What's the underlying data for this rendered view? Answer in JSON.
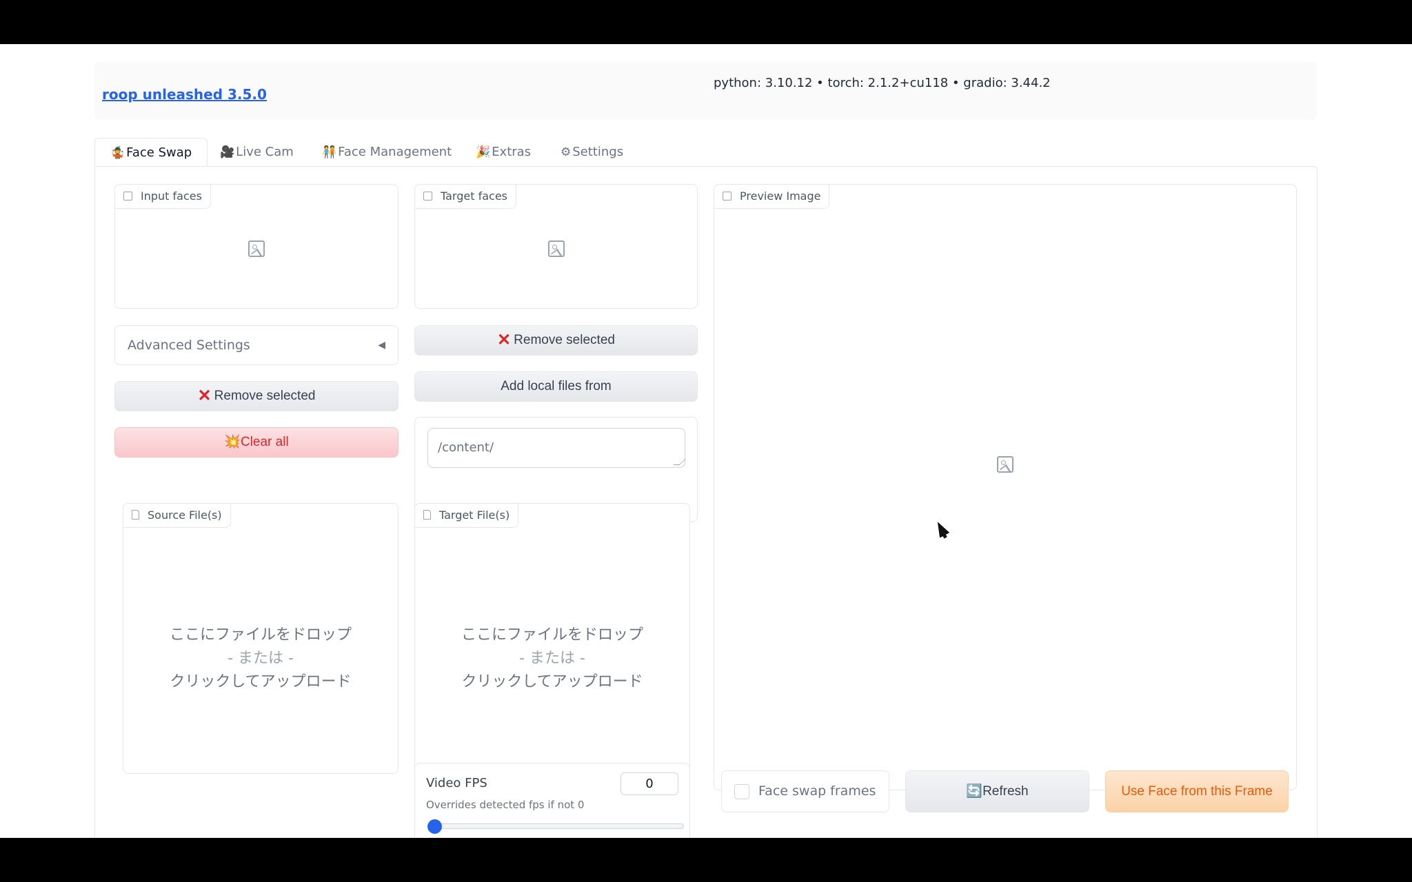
{
  "header": {
    "app_title": "roop unleashed 3.5.0",
    "versions": "python: 3.10.12 • torch: 2.1.2+cu118 • gradio: 3.44.2"
  },
  "tabs": [
    {
      "icon": "🤹",
      "label": "Face Swap"
    },
    {
      "icon": "🎥",
      "label": "Live Cam"
    },
    {
      "icon": "🧑‍🤝‍🧑",
      "label": "Face Management"
    },
    {
      "icon": "🎉",
      "label": "Extras"
    },
    {
      "icon": "⚙",
      "label": "Settings"
    }
  ],
  "input_faces": {
    "label": "Input faces"
  },
  "target_faces": {
    "label": "Target faces"
  },
  "preview": {
    "label": "Preview Image"
  },
  "advanced_settings": {
    "label": "Advanced Settings",
    "toggle_glyph": "◀"
  },
  "buttons": {
    "remove_selected_left": "Remove selected",
    "remove_selected_right": "Remove selected",
    "clear_all_icon": "💥",
    "clear_all": "Clear all",
    "add_local_files": "Add local files from",
    "refresh_icon": "🔄",
    "refresh": "Refresh",
    "use_face": "Use Face from this Frame",
    "x_glyph": "✕"
  },
  "local_path": {
    "value": "/content/"
  },
  "source_files": {
    "label": "Source File(s)",
    "drop_line1": "ここにファイルをドロップ",
    "drop_line2": "- または -",
    "drop_line3": "クリックしてアップロード"
  },
  "target_files": {
    "label": "Target File(s)",
    "drop_line1": "ここにファイルをドロップ",
    "drop_line2": "- または -",
    "drop_line3": "クリックしてアップロード"
  },
  "video_fps": {
    "label": "Video FPS",
    "info": "Overrides detected fps if not 0",
    "value": "0",
    "slider_fraction": 0
  },
  "face_swap_frames": {
    "label": "Face swap frames",
    "checked": false
  },
  "colors": {
    "link": "#2563eb",
    "danger": "#dc2626",
    "primary": "#ea580c",
    "slider": "#2563eb"
  }
}
